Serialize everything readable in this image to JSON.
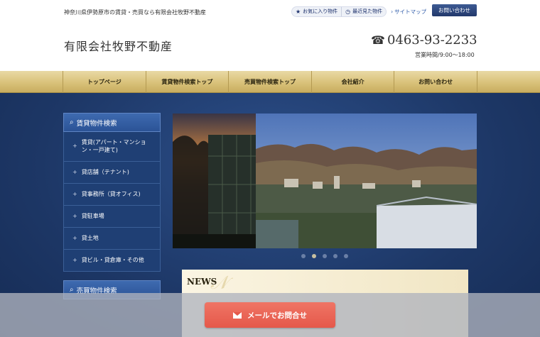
{
  "header": {
    "tagline": "神奈川県伊勢原市の賃貸・売買なら有限会社牧野不動産",
    "company_name": "有限会社牧野不動産",
    "favorites_label": "お気に入り物件",
    "recent_label": "最近見た物件",
    "sitemap_label": "サイトマップ",
    "contact_label": "お問い合わせ",
    "phone": "0463-93-2233",
    "hours": "営業時間/9:00～18:00"
  },
  "nav": {
    "items": [
      "トップページ",
      "賃貸物件検索トップ",
      "売買物件検索トップ",
      "会社紹介",
      "お問い合わせ"
    ]
  },
  "sidebar": {
    "rental_title": "賃貸物件検索",
    "rental_items": [
      "賃貸(アパート・マンション・一戸建て)",
      "貸店舗（テナント)",
      "貸事務所（貸オフィス)",
      "貸駐車場",
      "貸土地",
      "貸ビル・貸倉庫・その他"
    ],
    "sale_title": "売買物件検索"
  },
  "slider": {
    "dot_count": 5,
    "active_index": 1
  },
  "news": {
    "title": "NEWS"
  },
  "footer_bar": {
    "mail_label": "メールでお問合せ"
  },
  "colors": {
    "nav_gold": "#d9c27a",
    "main_blue": "#1d3766",
    "mail_button": "#e5584a"
  }
}
